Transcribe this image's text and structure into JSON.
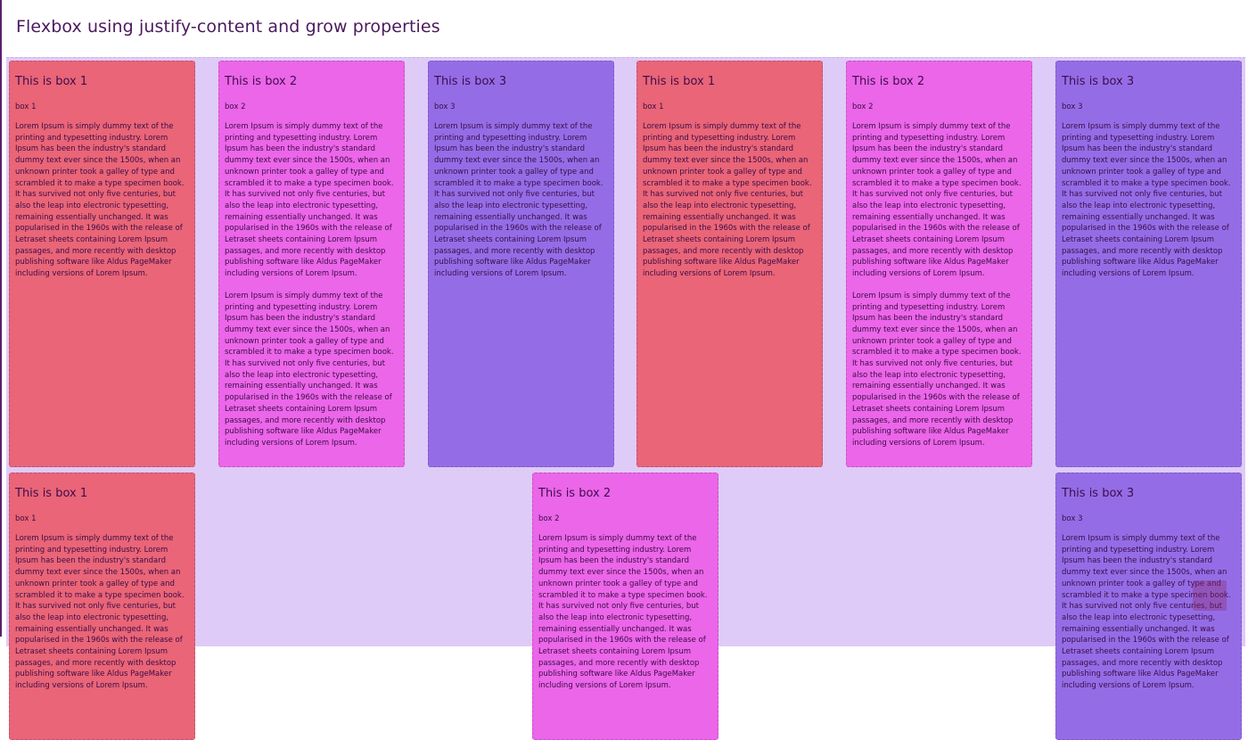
{
  "page": {
    "title": "Flexbox using justify-content and grow properties"
  },
  "lorem": "Lorem Ipsum is simply dummy text of the printing and typesetting industry. Lorem Ipsum has been the industry's standard dummy text ever since the 1500s, when an unknown printer took a galley of type and scrambled it to make a type specimen book. It has survived not only five centuries, but also the leap into electronic typesetting, remaining essentially unchanged. It was popularised in the 1960s with the release of Letraset sheets containing Lorem Ipsum passages, and more recently with desktop publishing software like Aldus PageMaker including versions of Lorem Ipsum.",
  "colors": {
    "box1": "#e96577",
    "box2": "#eb66e8",
    "box3": "#946de6",
    "container": "#dfcbf7",
    "title": "#4b1a5e"
  },
  "row1": [
    {
      "title": "This is box 1",
      "sub": "box 1",
      "color": "box1",
      "paragraphs": 1
    },
    {
      "title": "This is box 2",
      "sub": "box 2",
      "color": "box2",
      "paragraphs": 2
    },
    {
      "title": "This is box 3",
      "sub": "box 3",
      "color": "box3",
      "paragraphs": 1
    },
    {
      "title": "This is box 1",
      "sub": "box 1",
      "color": "box1",
      "paragraphs": 1
    },
    {
      "title": "This is box 2",
      "sub": "box 2",
      "color": "box2",
      "paragraphs": 2
    },
    {
      "title": "This is box 3",
      "sub": "box 3",
      "color": "box3",
      "paragraphs": 1
    }
  ],
  "row2": [
    {
      "title": "This is box 1",
      "sub": "box 1",
      "color": "box1",
      "paragraphs": 1
    },
    {
      "title": "This is box 2",
      "sub": "box 2",
      "color": "box2",
      "paragraphs": 1
    },
    {
      "title": "This is box 3",
      "sub": "box 3",
      "color": "box3",
      "paragraphs": 1
    }
  ]
}
